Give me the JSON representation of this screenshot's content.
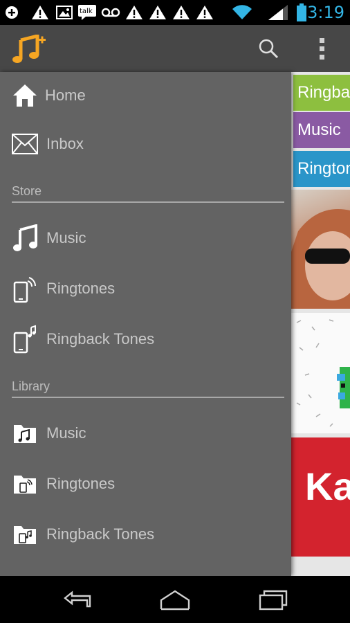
{
  "status_bar": {
    "time": "3:19",
    "talk_label": "talk",
    "icons": [
      "add-icon",
      "warning-icon",
      "image-icon",
      "talk-icon",
      "voicemail-icon",
      "warning-icon",
      "warning-icon",
      "warning-icon",
      "warning-icon",
      "wifi-icon",
      "signal-icon",
      "battery-icon"
    ]
  },
  "app_bar": {
    "logo": "music-plus-logo",
    "actions": [
      "search-icon",
      "overflow-menu-icon"
    ]
  },
  "drawer": {
    "top_items": [
      {
        "label": "Home",
        "icon": "home-icon"
      },
      {
        "label": "Inbox",
        "icon": "mail-icon"
      }
    ],
    "store": {
      "title": "Store",
      "items": [
        {
          "label": "Music",
          "icon": "music-note-icon"
        },
        {
          "label": "Ringtones",
          "icon": "ringing-phone-icon"
        },
        {
          "label": "Ringback Tones",
          "icon": "phone-music-icon"
        }
      ]
    },
    "library": {
      "title": "Library",
      "items": [
        {
          "label": "Music",
          "icon": "folder-music-icon"
        },
        {
          "label": "Ringtones",
          "icon": "folder-ringtone-icon"
        },
        {
          "label": "Ringback Tones",
          "icon": "folder-ringback-icon"
        }
      ]
    }
  },
  "content": {
    "tags": [
      "Ringback",
      "Music",
      "Ringtones"
    ],
    "thumb_text": "Karma"
  },
  "nav_bar": [
    "back-icon",
    "home-nav-icon",
    "recent-apps-icon"
  ],
  "colors": {
    "accent_blue": "#33b5e5",
    "logo_orange": "#f6a623",
    "tag_green": "#8dbf3f",
    "tag_purple": "#8a5aa3",
    "tag_blue": "#2a95c9"
  }
}
